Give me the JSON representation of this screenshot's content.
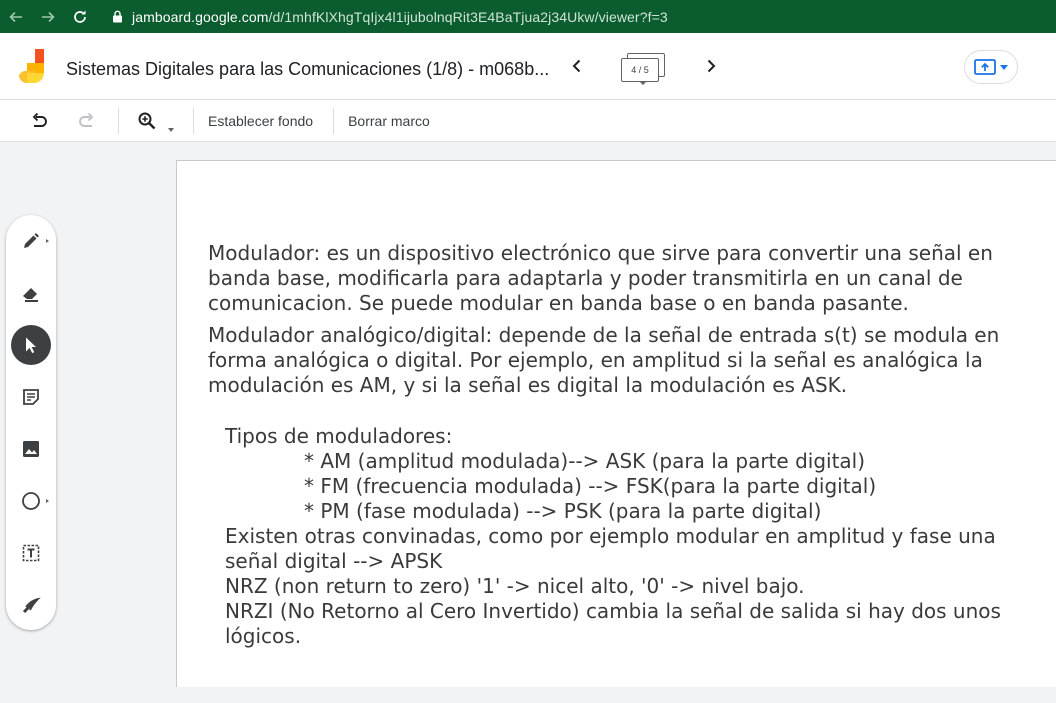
{
  "browser": {
    "url_domain": "jamboard.google.com",
    "url_path": "/d/1mhfKlXhgTqIjx4l1ijubolnqRit3E4BaTjua2j34Ukw/viewer?f=3",
    "back_icon": "arrow-left-icon",
    "forward_icon": "arrow-right-icon",
    "reload_icon": "reload-icon",
    "lock_icon": "lock-icon"
  },
  "header": {
    "title": "Sistemas Digitales para las Comunicaciones (1/8) - m068b...",
    "frame_counter": "4 / 5",
    "prev_icon": "chevron-left-icon",
    "next_icon": "chevron-right-icon",
    "share_icon": "present-icon"
  },
  "toolbar": {
    "undo_icon": "undo-icon",
    "redo_icon": "redo-icon",
    "zoom_icon": "zoom-in-icon",
    "set_background_label": "Establecer fondo",
    "clear_frame_label": "Borrar marco"
  },
  "palette": {
    "tools": [
      "pen-icon",
      "eraser-icon",
      "select-icon",
      "sticky-note-icon",
      "image-icon",
      "circle-icon",
      "text-box-icon",
      "laser-icon"
    ],
    "active": "select-icon"
  },
  "canvas": {
    "p1": "Modulador: es  un dispositivo electrónico que sirve para convertir una señal en banda base, modificarla para adaptarla y poder transmitirla en un canal de comunicacion. Se puede modular en banda base o en banda pasante.",
    "p2": "Modulador analógico/digital: depende de la señal de entrada s(t) se modula en forma analógica o digital. Por ejemplo, en amplitud si la señal es analógica la modulación es AM, y si la señal es digital la modulación es ASK.",
    "types_heading": "Tipos de moduladores:",
    "types": [
      "* AM (amplitud modulada)--> ASK (para la parte digital)",
      "* FM (frecuencia modulada) --> FSK(para la parte digital)",
      "* PM (fase modulada) --> PSK (para la parte digital)"
    ],
    "p3": "Existen otras convinadas, como por ejemplo modular en amplitud y fase una señal digital --> APSK",
    "p4": "NRZ (non return to zero) '1' -> nicel alto, '0' -> nivel bajo.",
    "p5": "NRZI (No Retorno al Cero Invertido) cambia la señal de salida si hay dos unos lógicos."
  }
}
